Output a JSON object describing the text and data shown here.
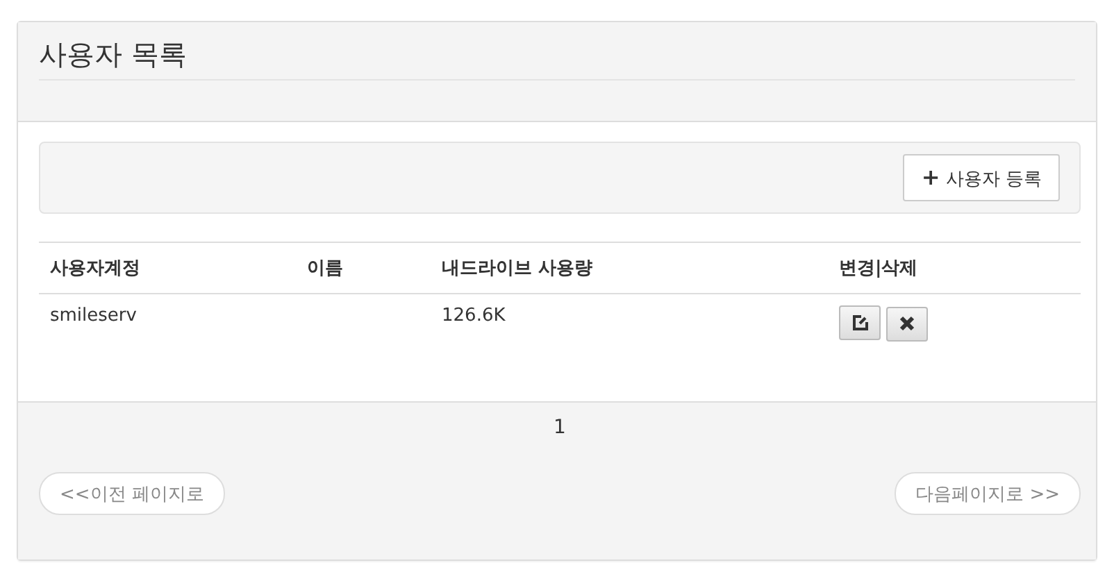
{
  "panel": {
    "title": "사용자 목록"
  },
  "toolbar": {
    "add_button": {
      "icon": "+",
      "label": "사용자 등록"
    }
  },
  "table": {
    "columns": [
      "사용자계정",
      "이름",
      "내드라이브 사용량",
      "변경|삭제"
    ],
    "rows": [
      {
        "cells": [
          "smileserv",
          "",
          "126.6K"
        ],
        "actions": [
          {
            "kind": "edit"
          },
          {
            "kind": "delete"
          }
        ]
      }
    ]
  },
  "pagination": {
    "pages": [
      {
        "label": "1",
        "selected": true
      }
    ],
    "prev": {
      "label": "<<이전 페이지로",
      "disabled": true
    },
    "next": {
      "label": "다음페이지로 >>",
      "disabled": true
    }
  }
}
